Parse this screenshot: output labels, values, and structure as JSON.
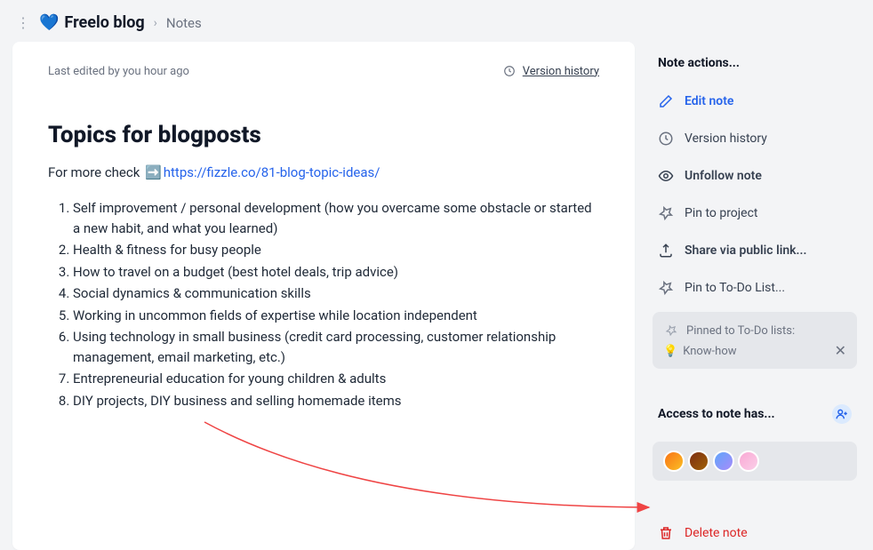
{
  "header": {
    "project_emoji": "💙",
    "project_title": "Freelo blog",
    "crumb_sep": "›",
    "crumb_notes": "Notes"
  },
  "note": {
    "last_edited": "Last edited by you hour ago",
    "version_history_label": "Version history",
    "title": "Topics for blogposts",
    "intro_prefix": "For more check ",
    "arrow_emoji": "➡️",
    "link_text": "https://fizzle.co/81-blog-topic-ideas/",
    "topics": [
      "Self improvement / personal development (how you overcame some obstacle or started a new habit, and what you learned)",
      "Health & fitness for busy people",
      "How to travel on a budget (best hotel deals, trip advice)",
      "Social dynamics & communication skills",
      "Working in uncommon fields of expertise while location independent",
      "Using technology in small business (credit card processing, customer relationship management, email marketing, etc.)",
      "Entrepreneurial education for young children & adults",
      "DIY projects, DIY business and selling homemade items"
    ]
  },
  "sidebar": {
    "actions_title": "Note actions...",
    "edit_note": "Edit note",
    "version_history": "Version history",
    "unfollow_note": "Unfollow note",
    "pin_to_project": "Pin to project",
    "share_public": "Share via public link...",
    "pin_to_todo": "Pin to To-Do List...",
    "pinned_label": "Pinned to To-Do lists:",
    "pinned_emoji": "💡",
    "pinned_name": "Know-how",
    "access_title": "Access to note has...",
    "delete_note": "Delete note"
  }
}
